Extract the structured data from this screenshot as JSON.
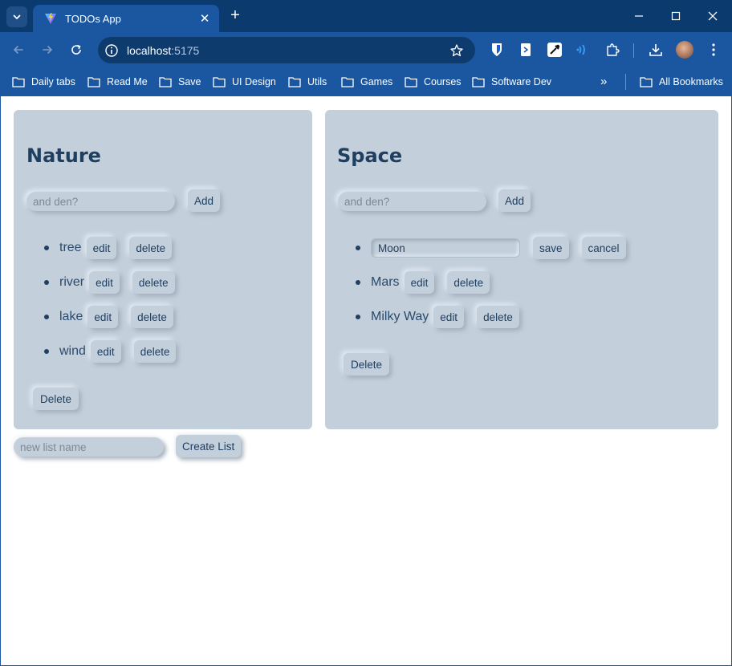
{
  "browser": {
    "tab_title": "TODOs App",
    "url_host": "localhost",
    "url_port": ":5175",
    "bookmarks": [
      "Daily tabs",
      "Read Me",
      "Save",
      "UI Design",
      "Utils",
      "Games",
      "Courses",
      "Software Dev"
    ],
    "all_bookmarks": "All Bookmarks"
  },
  "lists": [
    {
      "title": "Nature",
      "add_placeholder": "and den?",
      "add_label": "Add",
      "todos": [
        {
          "text": "tree"
        },
        {
          "text": "river"
        },
        {
          "text": "lake"
        },
        {
          "text": "wind"
        }
      ],
      "delete_label": "Delete"
    },
    {
      "title": "Space",
      "add_placeholder": "and den?",
      "add_label": "Add",
      "editing": {
        "value": "Moon",
        "save_label": "save",
        "cancel_label": "cancel"
      },
      "todos": [
        {
          "text": "Mars"
        },
        {
          "text": "Milky Way"
        }
      ],
      "delete_label": "Delete"
    }
  ],
  "todo_actions": {
    "edit_label": "edit",
    "delete_label": "delete"
  },
  "new_list": {
    "placeholder": "new list name",
    "button_label": "Create List"
  }
}
